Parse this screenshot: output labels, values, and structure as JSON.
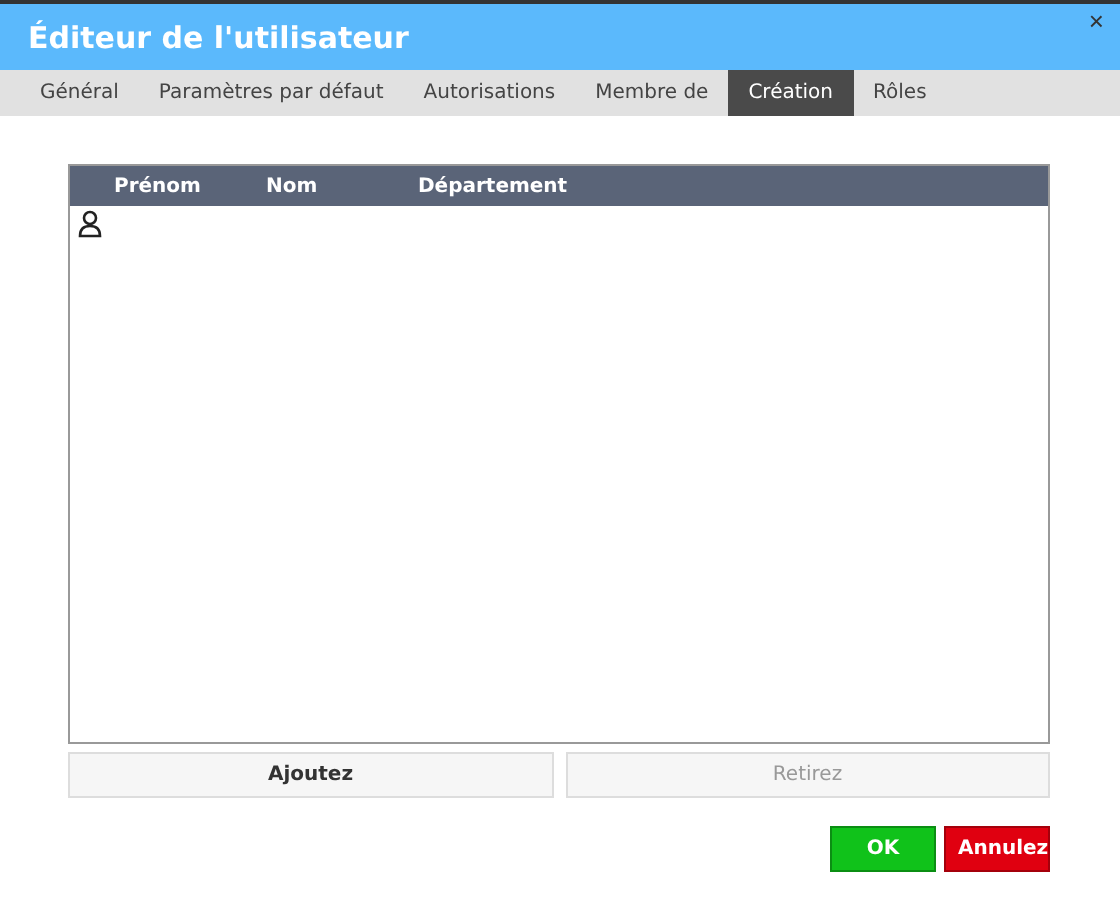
{
  "window": {
    "title": "Éditeur de l'utilisateur",
    "close": "×"
  },
  "tabs": [
    {
      "label": "Général",
      "selected": false
    },
    {
      "label": "Paramètres par défaut",
      "selected": false
    },
    {
      "label": "Autorisations",
      "selected": false
    },
    {
      "label": "Membre de",
      "selected": false
    },
    {
      "label": "Création",
      "selected": true
    },
    {
      "label": "Rôles",
      "selected": false
    }
  ],
  "table": {
    "columns": [
      "Prénom",
      "Nom",
      "Département"
    ],
    "rows": [
      {
        "kind": "user"
      }
    ]
  },
  "list_buttons": [
    {
      "label": "Ajoutez",
      "disabled": false
    },
    {
      "label": "Retirez",
      "disabled": true
    }
  ],
  "footer_buttons": [
    {
      "label": "OK",
      "kind": "confirm"
    },
    {
      "label": "Annulez",
      "kind": "cancel"
    }
  ]
}
